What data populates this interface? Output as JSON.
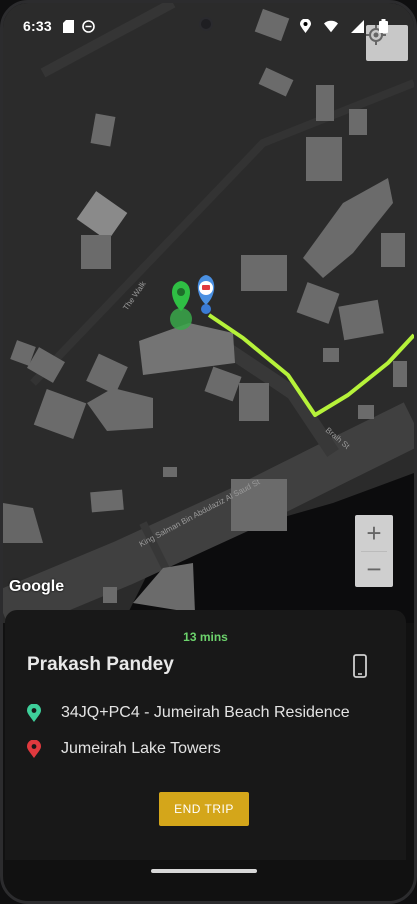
{
  "status_bar": {
    "time": "6:33"
  },
  "map": {
    "attribution": "Google",
    "street_labels": [
      "King Salman Bin Abdulaziz Al Saud St",
      "Braih St",
      "The Walk"
    ],
    "zoom_in_label": "+",
    "zoom_out_label": "−"
  },
  "trip": {
    "eta": "13 mins",
    "driver_name": "Prakash Pandey",
    "pickup": "34JQ+PC4 - Jumeirah Beach Residence",
    "dropoff": "Jumeirah Lake Towers",
    "end_trip_label": "END TRIP"
  },
  "colors": {
    "eta": "#6cd26c",
    "route": "#b6f23a",
    "pickup_pin": "#3ecf9a",
    "dropoff_pin": "#e0393e",
    "end_button": "#d4a61a"
  }
}
